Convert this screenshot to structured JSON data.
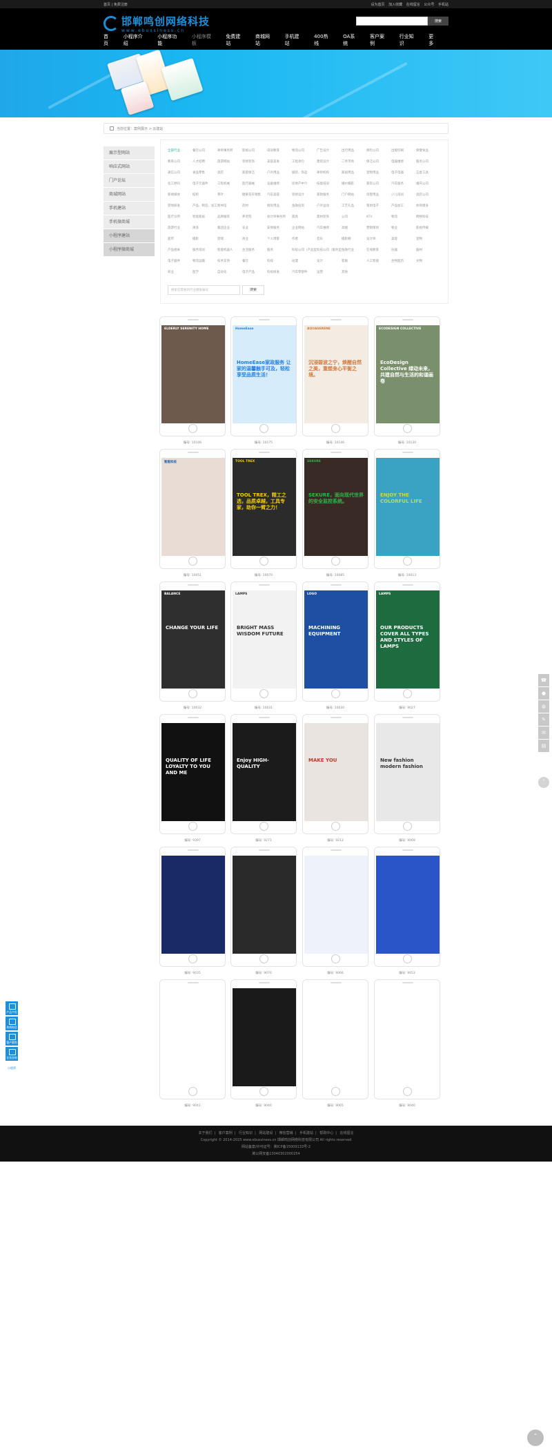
{
  "topbar": {
    "left": "首页 | 免费注册",
    "links": [
      "设为首页",
      "加入收藏",
      "在线留言",
      "公众号",
      "手机站"
    ]
  },
  "header": {
    "logo_cn": "邯郸鸣创网络科技",
    "logo_en": "www.ebussiness.cn",
    "search_button": "搜索",
    "nav": [
      "首页",
      "小程序介绍",
      "小程序功能",
      "小程序模板",
      "免费建站",
      "商城网站",
      "手机建站",
      "400热线",
      "OA系统",
      "客户案例",
      "行业知识",
      "更多"
    ]
  },
  "breadcrumb": "当前位置：案例展示 > 云建站",
  "sidebar": [
    "展示型网站",
    "响应式网站",
    "门户论坛",
    "商城网站",
    "手机建站",
    "手机微商城",
    "小程序建站",
    "小程序微商城"
  ],
  "tags": [
    "全部行业",
    "餐饮公司",
    "律师事务所",
    "影视公司",
    "培训教育",
    "物流公司",
    "广告设计",
    "出行用品",
    "保险公司",
    "出版印刷",
    "保健食品",
    "教育公司",
    "人才招聘",
    "旅游网站",
    "装修装饰",
    "美容美发",
    "工程承包",
    "建筑设计",
    "二手市场",
    "保洁公司",
    "电器维修",
    "服务公司",
    "通信公司",
    "食品零售",
    "酒店",
    "家庭保洁",
    "户外用品",
    "服装、饰品",
    "律师机构",
    "家居用品",
    "宠物用品",
    "电子电器",
    "五金工具",
    "化工原料",
    "电子元器件",
    "工程机械",
    "医疗器械",
    "设备维修",
    "房地产中介",
    "技能培训",
    "婚纱摄影",
    "家装公司",
    "汽车服务",
    "婚庆公司",
    "新闻媒体",
    "纺织",
    "茶叶",
    "糖果花卉销售",
    "汽车美容",
    "装修设计",
    "家政服务",
    "门户网站",
    "母婴用品",
    "少儿培训",
    "酒店公司",
    "游戏研发",
    "产品、制造、加工",
    "图书馆",
    "药材",
    "厨房用品",
    "金融投资",
    "户外运动",
    "工艺礼品",
    "策划电子",
    "产品加工",
    "体育健身",
    "医疗诊所",
    "智能家居",
    "品牌服装",
    "养老院",
    "会计师事务所",
    "家具",
    "建材装饰",
    "公司",
    "KTV",
    "物流",
    "网络科技",
    "旅游行业",
    "清洗",
    "集团企业",
    "农业",
    "安保服务",
    "企业网站",
    "汽车维修",
    "高端",
    "营销策划",
    "物业",
    "影视传媒",
    "超市",
    "摄影",
    "游戏",
    "商业",
    "个人博客",
    "作者",
    "音乐",
    "摄影棚",
    "设计师",
    "美容",
    "宠物",
    "产品相关",
    "服务培训",
    "智能机器人",
    "生活服务",
    "服务",
    "科技公司（产品型）",
    "科技公司（服务型）",
    "金融行业",
    "在线教育",
    "乐器",
    "器材",
    "电子器件",
    "物流运输",
    "技术支持",
    "餐饮",
    "科技",
    "动漫",
    "设计",
    "客服",
    "人工智能",
    "生物医药",
    "文物",
    "商业",
    "医学",
    "自动化",
    "电子产品",
    "科技研发",
    "汽车零部件",
    "运营",
    "其他"
  ],
  "tag_search_placeholder": "搜索您需要的行业模板编号",
  "tag_search_button": "搜索",
  "cards": [
    {
      "code": "编号: 10106",
      "screen_top": "ELDERLY SERENITY HOME",
      "screen_title": "",
      "bg": "#6e5a4d",
      "accent": "#ffffff"
    },
    {
      "code": "编号: 10175",
      "screen_top": "HomeEase",
      "screen_title": "HomeEase家政服务 让家的温馨触手可及，轻松享受品质生活！",
      "bg": "#d7ecfb",
      "accent": "#1e7ee0"
    },
    {
      "code": "编号: 10146",
      "screen_top": "AQUASERENE",
      "screen_title": "沉浸碧波之宁，焕醒自然之美，重塑身心平衡之境。",
      "bg": "#f3ece3",
      "accent": "#d3763b"
    },
    {
      "code": "编号: 10130",
      "screen_top": "ECODESIGN COLLECTIVE",
      "screen_title": "EcoDesign Collective 绿动未来，共建自然与生活的和谐画卷",
      "bg": "#7a8f6b",
      "accent": "#ffffff"
    },
    {
      "code": "编号: 10051",
      "screen_top": "智能科技",
      "screen_title": "",
      "bg": "#e8dcd4",
      "accent": "#1a5fb0"
    },
    {
      "code": "编号: 10070",
      "screen_top": "TOOL TREX",
      "screen_title": "TOOL TREX，精工之选，品质卓越，工具专家，助你一臂之力！",
      "bg": "#2b2b2b",
      "accent": "#f5d000"
    },
    {
      "code": "编号: 10085",
      "screen_top": "SEKURE",
      "screen_title": "SEKURE，面向现代世界的安全监控系统。",
      "bg": "#3a2a26",
      "accent": "#2db84a"
    },
    {
      "code": "编号: 10013",
      "screen_top": "",
      "screen_title": "ENJOY THE COLORFUL LIFE",
      "bg": "#3aa3c4",
      "accent": "#c8d84a"
    },
    {
      "code": "编号: 10032",
      "screen_top": "BALANCE",
      "screen_title": "CHANGE YOUR LIFE",
      "bg": "#2f2f2f",
      "accent": "#ffffff"
    },
    {
      "code": "编号: 10031",
      "screen_top": "LAMPS",
      "screen_title": "BRIGHT MASS WISDOM FUTURE",
      "bg": "#f2f2f2",
      "accent": "#333333"
    },
    {
      "code": "编号: 10030",
      "screen_top": "LOGO",
      "screen_title": "MACHINING EQUIPMENT",
      "bg": "#1e4fa0",
      "accent": "#ffffff"
    },
    {
      "code": "编号: 9027",
      "screen_top": "LAMPS",
      "screen_title": "OUR PRODUCTS COVER ALL TYPES AND STYLES OF LAMPS",
      "bg": "#1e6b3f",
      "accent": "#ffffff"
    },
    {
      "code": "编号: 9397",
      "screen_top": "",
      "screen_title": "QUALITY OF LIFE LOYALTY TO YOU AND ME",
      "bg": "#111111",
      "accent": "#ffffff"
    },
    {
      "code": "编号: 9271",
      "screen_top": "",
      "screen_title": "Enjoy HIGH-QUALITY",
      "bg": "#1b1b1b",
      "accent": "#ffffff"
    },
    {
      "code": "编号: 9213",
      "screen_top": "",
      "screen_title": "MAKE YOU",
      "bg": "#e9e4df",
      "accent": "#c0392b"
    },
    {
      "code": "编号: 9069",
      "screen_top": "",
      "screen_title": "New fashion modern fashion",
      "bg": "#e8e8e8",
      "accent": "#333333"
    },
    {
      "code": "编号: 9035",
      "screen_top": "",
      "screen_title": "",
      "bg": "#1a2a66",
      "accent": "#ffffff"
    },
    {
      "code": "编号: 9070",
      "screen_top": "",
      "screen_title": "",
      "bg": "#2a2a2a",
      "accent": "#ffffff"
    },
    {
      "code": "编号: 9066",
      "screen_top": "",
      "screen_title": "",
      "bg": "#eef3fb",
      "accent": "#e56aa6"
    },
    {
      "code": "编号: 9053",
      "screen_top": "",
      "screen_title": "",
      "bg": "#2a55c8",
      "accent": "#ffffff"
    },
    {
      "code": "编号: 9041",
      "screen_top": "",
      "screen_title": "",
      "bg": "#ffffff",
      "accent": "#b01c1c"
    },
    {
      "code": "编号: 9040",
      "screen_top": "",
      "screen_title": "",
      "bg": "#1a1a1a",
      "accent": "#ffffff"
    },
    {
      "code": "编号: 9065",
      "screen_top": "",
      "screen_title": "",
      "bg": "#ffffff",
      "accent": "#333333"
    },
    {
      "code": "编号: 9040",
      "screen_top": "",
      "screen_title": "",
      "bg": "#ffffff",
      "accent": "#111111"
    }
  ],
  "footer": {
    "links": [
      "关于我们",
      "客户案例",
      "行业知识",
      "网站建设",
      "微信营销",
      "手机建站",
      "帮助中心",
      "在线留言"
    ],
    "copyright": "Copyright © 2014-2025 www.ebussiness.cn 邯郸鸣创网络科技有限公司 All rights reserved",
    "icp": "网站备案/许可证号：冀ICP备15009133号-2",
    "police": "冀公网安备13040302000254"
  },
  "left_tools": [
    "产品介绍",
    "热线电话",
    "客户案例",
    "业务咨询"
  ],
  "left_tools_mini": "小程序"
}
